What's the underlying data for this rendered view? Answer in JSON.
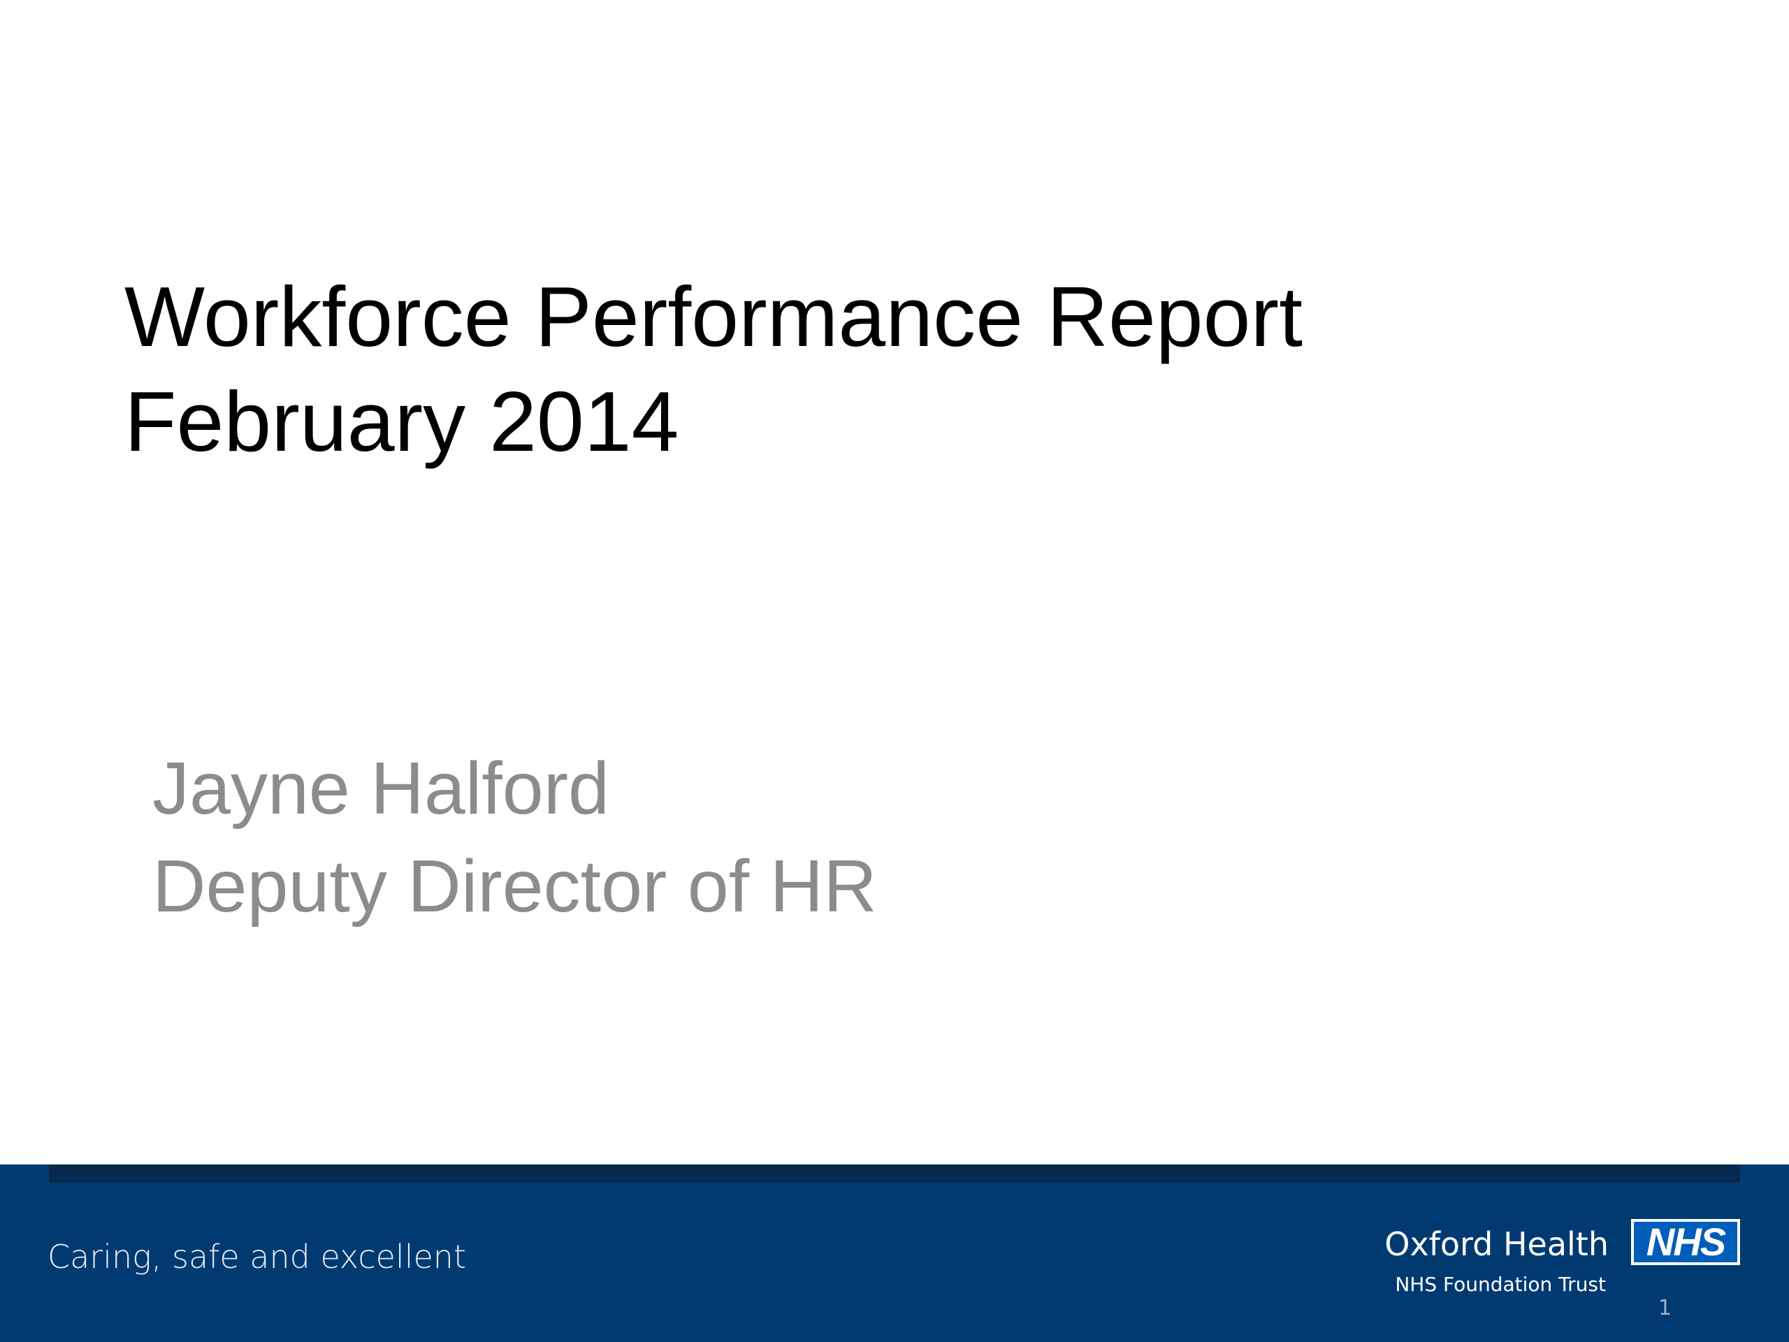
{
  "slide": {
    "title_lines": [
      "Workforce Performance Report",
      "February 2014"
    ],
    "subtitle_lines": [
      "Jayne Halford",
      "Deputy Director of HR"
    ],
    "page_number": "1"
  },
  "footer": {
    "tagline": "Caring, safe and excellent",
    "org_name": "Oxford Health",
    "org_subtitle": "NHS Foundation Trust",
    "logo_text": "NHS"
  },
  "colors": {
    "footer_band": "#003a70",
    "nhs_blue": "#005eb8",
    "subtitle_grey": "#8c8c8c"
  }
}
